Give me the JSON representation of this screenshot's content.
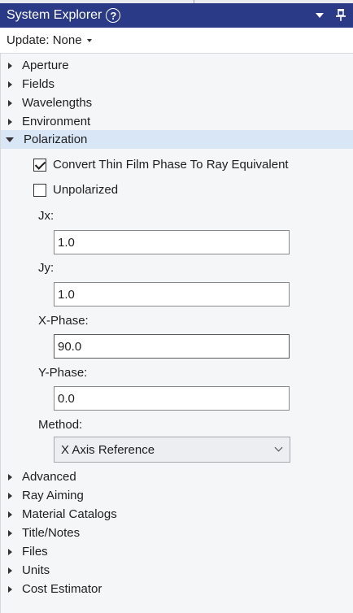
{
  "titlebar": {
    "title": "System Explorer",
    "help_glyph": "?"
  },
  "update": {
    "label": "Update: None"
  },
  "tree_before": [
    "Aperture",
    "Fields",
    "Wavelengths",
    "Environment"
  ],
  "expanded_section": "Polarization",
  "polarization": {
    "convert_label": "Convert Thin Film Phase To Ray Equivalent",
    "convert_checked": true,
    "unpolarized_label": "Unpolarized",
    "unpolarized_checked": false,
    "jx_label": "Jx:",
    "jx_value": "1.0",
    "jy_label": "Jy:",
    "jy_value": "1.0",
    "xphase_label": "X-Phase:",
    "xphase_value": "90.0",
    "yphase_label": "Y-Phase:",
    "yphase_value": "0.0",
    "method_label": "Method:",
    "method_value": "X Axis Reference"
  },
  "tree_after": [
    "Advanced",
    "Ray Aiming",
    "Material Catalogs",
    "Title/Notes",
    "Files",
    "Units",
    "Cost Estimator"
  ],
  "colors": {
    "titlebar": "#2b3a87",
    "selected_row": "#d9e6f5",
    "panel": "#f5f6f8"
  },
  "icons": [
    "help-icon",
    "dropdown-icon",
    "pin-icon",
    "expand-arrow-icon",
    "collapse-arrow-icon",
    "chevron-down-icon"
  ]
}
